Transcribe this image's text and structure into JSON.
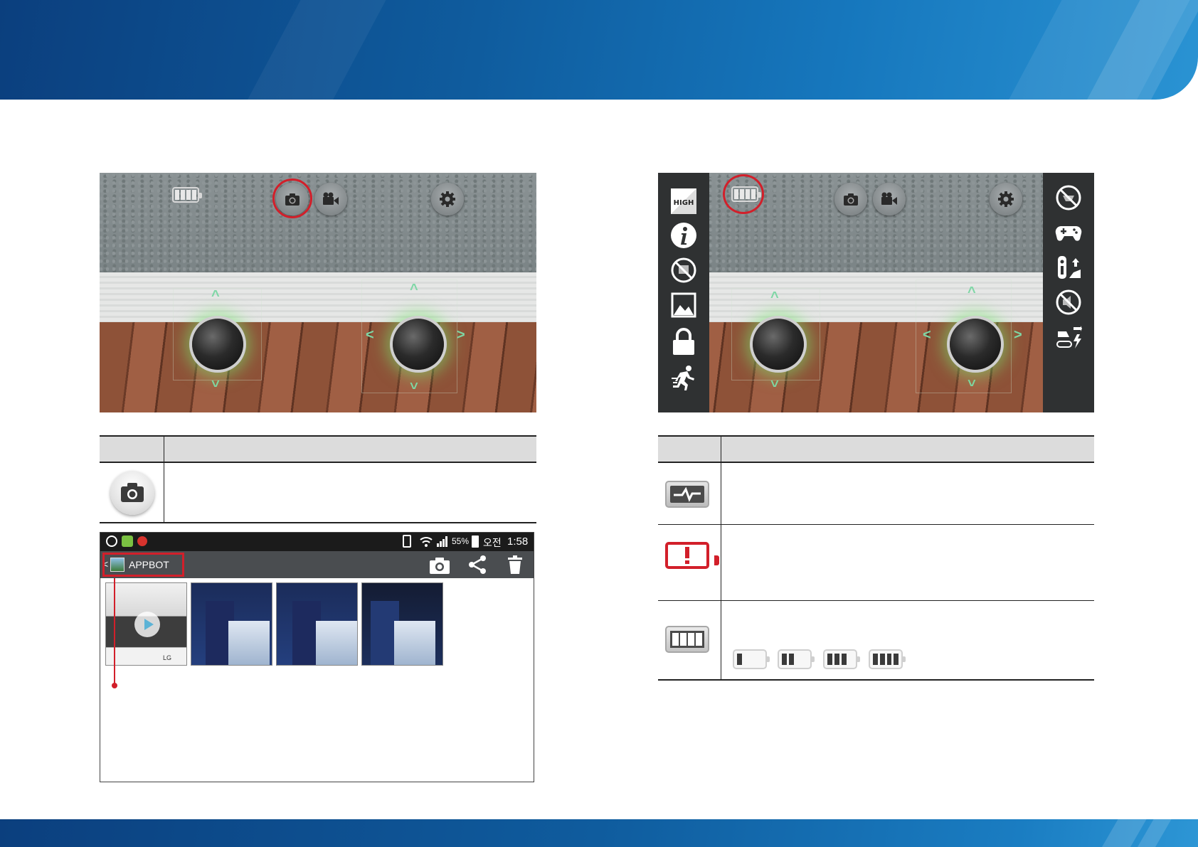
{
  "gallery": {
    "status": {
      "battery_percent": "55%",
      "ampm": "오전",
      "time": "1:58"
    },
    "album_title": "APPBOT",
    "action_icons": [
      "camera-icon",
      "share-icon",
      "trash-icon"
    ],
    "thumbnails": [
      {
        "kind": "video",
        "caption": "LG"
      },
      {
        "kind": "photo"
      },
      {
        "kind": "photo"
      },
      {
        "kind": "photo"
      }
    ]
  },
  "scene_left": {
    "top_icons": [
      "battery-icon",
      "camera-icon",
      "video-camera-icon",
      "gear-icon"
    ],
    "highlighted": "camera-icon"
  },
  "scene_right": {
    "top_icons": [
      "battery-icon",
      "camera-icon",
      "video-camera-icon",
      "gear-icon"
    ],
    "highlighted": "battery-icon",
    "left_menu": [
      "high-quality-icon",
      "info-icon",
      "no-stream-icon",
      "picture-icon",
      "lock-icon",
      "running-man-icon"
    ],
    "right_menu": [
      "no-monitoring-icon",
      "gamepad-icon",
      "remote-upload-icon",
      "mute-icon",
      "auto-charge-icon"
    ]
  },
  "battery_levels": [
    1,
    2,
    3,
    4
  ],
  "colors": {
    "accent_red": "#d21f2a",
    "header_blue": "#0f5c9e",
    "joystick_glow": "#78e66e"
  }
}
